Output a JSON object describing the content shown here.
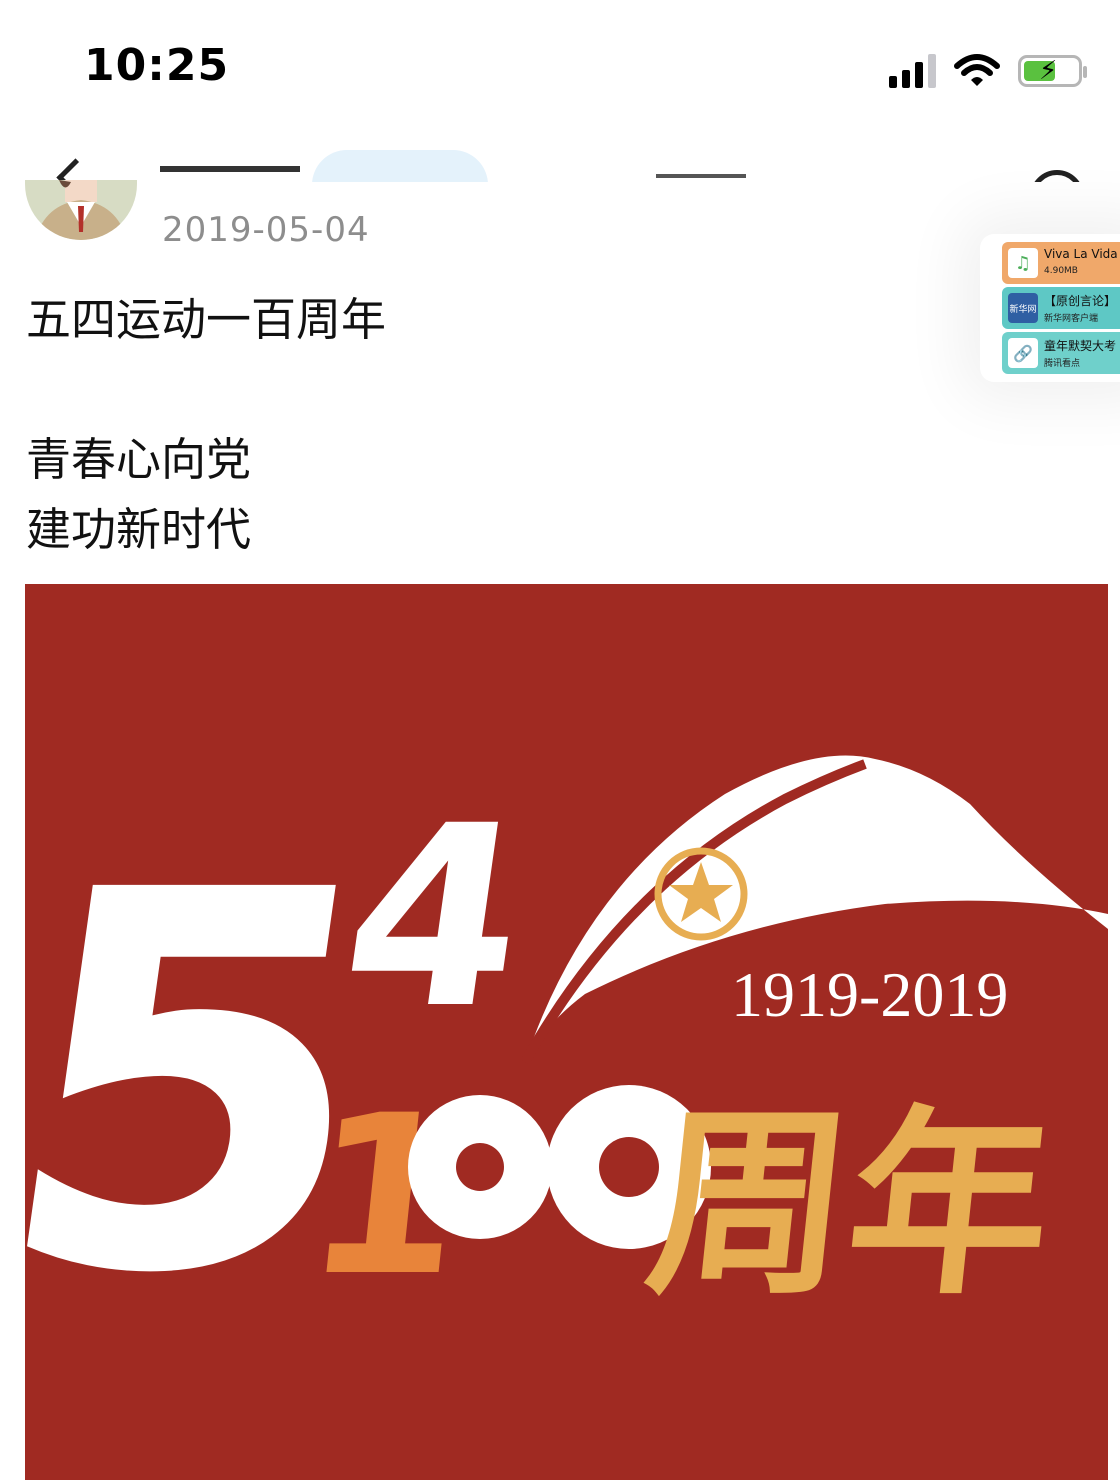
{
  "status_bar": {
    "time": "10:25"
  },
  "post": {
    "date": "2019-05-04",
    "lines": [
      "五四运动一百周年",
      "青春心向党",
      "建功新时代"
    ]
  },
  "share_panel": {
    "items": [
      {
        "title": "Viva La Vida",
        "subtitle": "4.90MB",
        "icon": "music-note-icon"
      },
      {
        "title": "【原创言论】",
        "subtitle": "新华网客户端",
        "icon_label": "新华网"
      },
      {
        "title": "童年默契大考",
        "subtitle": "腾讯看点",
        "icon": "link-icon"
      }
    ]
  },
  "image": {
    "years": "1919-2019",
    "number_top": "54",
    "number_bottom": "100",
    "anniversary": "周年",
    "colors": {
      "background": "#a02a22",
      "white": "#ffffff",
      "orange": "#e8843a",
      "gold": "#e7ad52"
    }
  }
}
